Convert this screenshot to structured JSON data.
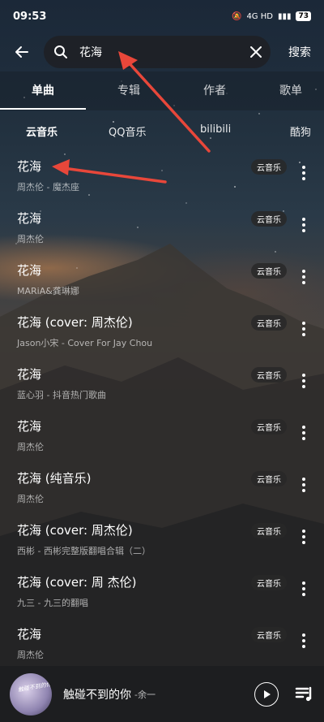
{
  "status_bar": {
    "time": "09:53",
    "network": "4G HD",
    "battery": "73"
  },
  "search": {
    "query": "花海",
    "search_label": "搜索"
  },
  "tabs": [
    {
      "label": "单曲",
      "active": true
    },
    {
      "label": "专辑",
      "active": false
    },
    {
      "label": "作者",
      "active": false
    },
    {
      "label": "歌单",
      "active": false
    }
  ],
  "sources": [
    {
      "label": "云音乐",
      "active": true
    },
    {
      "label": "QQ音乐",
      "active": false
    },
    {
      "label": "bilibili",
      "active": false
    },
    {
      "label": "酷狗",
      "active": false
    }
  ],
  "songs": [
    {
      "title": "花海",
      "subtitle": "周杰伦 - 魔杰座",
      "badge": "云音乐"
    },
    {
      "title": "花海",
      "subtitle": "周杰伦",
      "badge": "云音乐"
    },
    {
      "title": "花海",
      "subtitle": "MARiA&龚琳娜",
      "badge": "云音乐"
    },
    {
      "title": "花海 (cover: 周杰伦)",
      "subtitle": "Jason小宋 - Cover For Jay Chou",
      "badge": "云音乐"
    },
    {
      "title": "花海",
      "subtitle": "蓝心羽 - 抖音热门歌曲",
      "badge": "云音乐"
    },
    {
      "title": "花海",
      "subtitle": "周杰伦",
      "badge": "云音乐"
    },
    {
      "title": "花海 (纯音乐)",
      "subtitle": "周杰伦",
      "badge": "云音乐"
    },
    {
      "title": "花海 (cover: 周杰伦)",
      "subtitle": "西彬 - 西彬完整版翻唱合辑（二）",
      "badge": "云音乐"
    },
    {
      "title": "花海 (cover: 周 杰伦)",
      "subtitle": "九三 - 九三的翻唱",
      "badge": "云音乐"
    },
    {
      "title": "花海",
      "subtitle": "周杰伦",
      "badge": "云音乐"
    }
  ],
  "player": {
    "song": "触碰不到的你",
    "artist": "-余一",
    "cover_text": "触碰不到的你"
  },
  "colors": {
    "annotation_arrow": "#e8473a"
  }
}
